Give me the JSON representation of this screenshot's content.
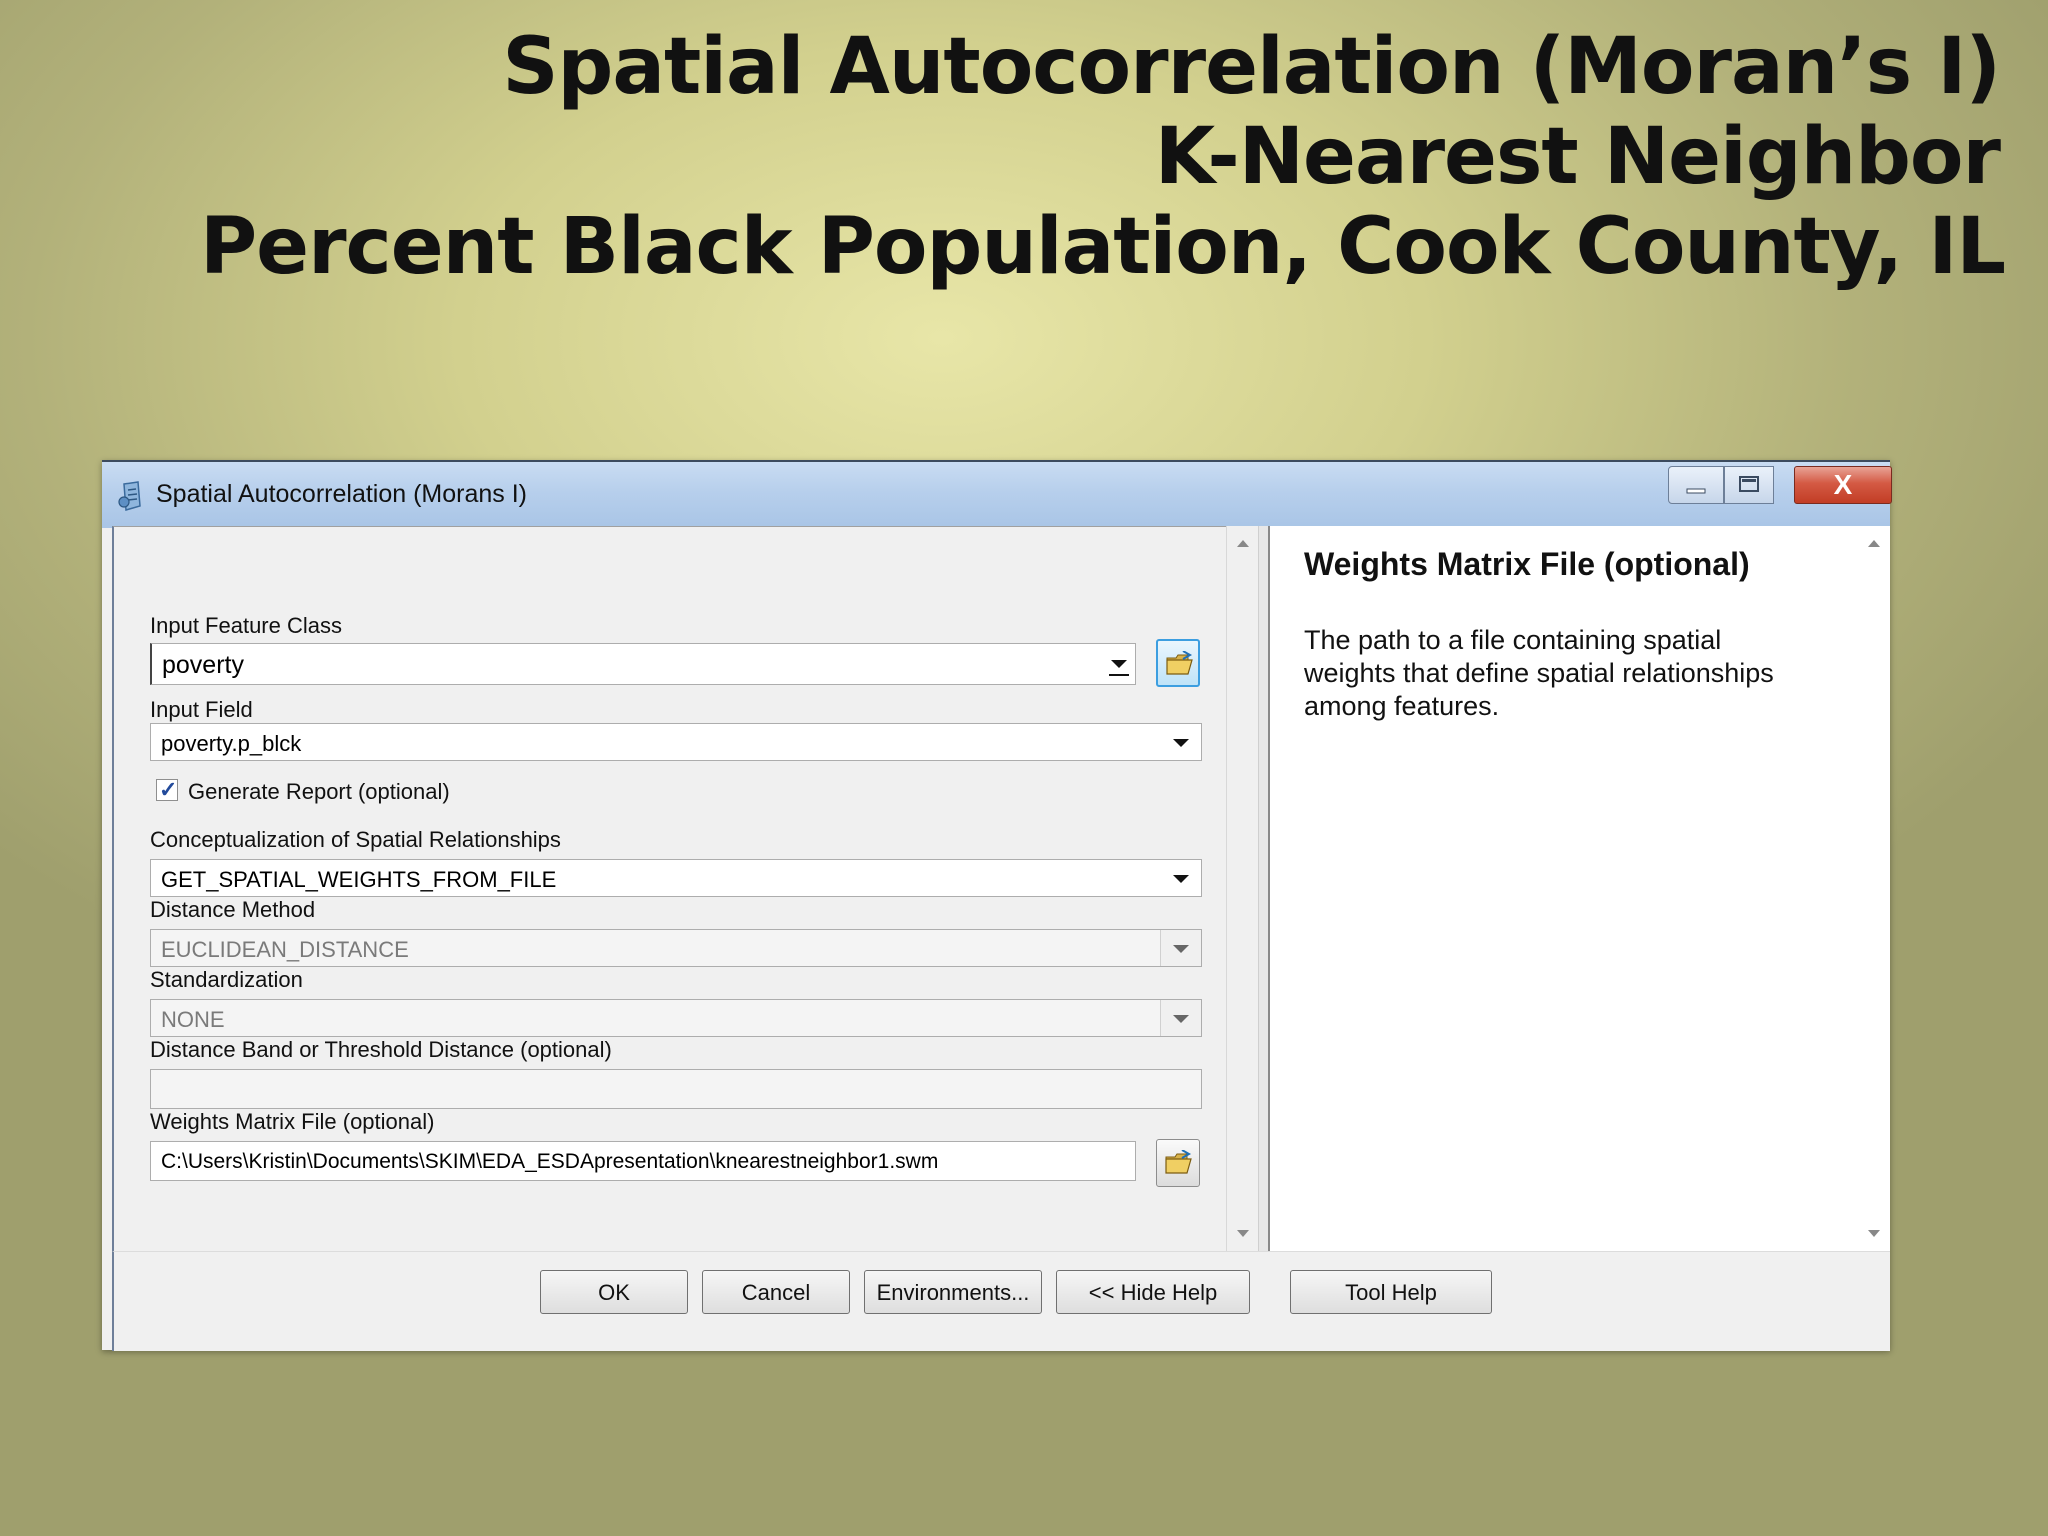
{
  "slide": {
    "title_line1": "Spatial Autocorrelation (Moran’s I)",
    "title_line2": "K-Nearest Neighbor",
    "title_line3": "Percent Black Population, Cook County, IL"
  },
  "window": {
    "title": "Spatial Autocorrelation (Morans I)",
    "close_glyph": "X"
  },
  "form": {
    "input_feature_class": {
      "label": "Input Feature Class",
      "value": "poverty"
    },
    "input_field": {
      "label": "Input Field",
      "value": "poverty.p_blck"
    },
    "generate_report": {
      "label": "Generate Report (optional)",
      "checked": true,
      "check_glyph": "✓"
    },
    "conceptualization": {
      "label": "Conceptualization of Spatial Relationships",
      "value": "GET_SPATIAL_WEIGHTS_FROM_FILE"
    },
    "distance_method": {
      "label": "Distance Method",
      "value": "EUCLIDEAN_DISTANCE"
    },
    "standardization": {
      "label": "Standardization",
      "value": "NONE"
    },
    "distance_band": {
      "label": "Distance Band or Threshold Distance (optional)",
      "value": ""
    },
    "weights_matrix": {
      "label": "Weights Matrix File (optional)",
      "value": "C:\\Users\\Kristin\\Documents\\SKIM\\EDA_ESDApresentation\\knearestneighbor1.swm"
    }
  },
  "help": {
    "title": "Weights Matrix File (optional)",
    "text": "The path to a file containing spatial weights that define spatial relationships among features."
  },
  "buttons": {
    "ok": "OK",
    "cancel": "Cancel",
    "environments": "Environments...",
    "hide_help": "<< Hide Help",
    "tool_help": "Tool Help"
  },
  "colors": {
    "titlebar": "#b7cfec",
    "close_button": "#c94a32",
    "dialog_background": "#f0f0f0"
  }
}
